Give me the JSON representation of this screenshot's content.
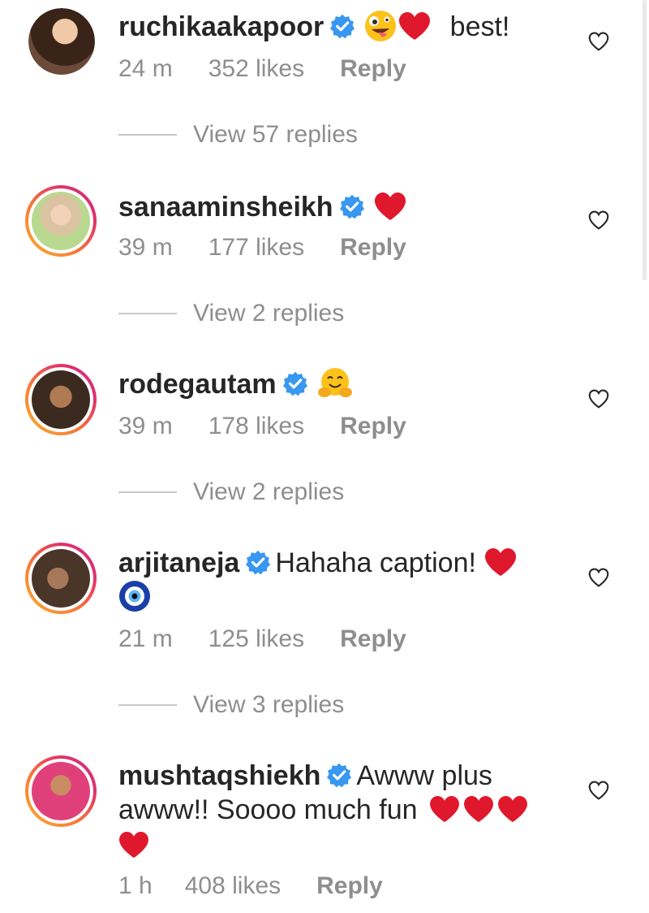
{
  "comments": [
    {
      "username": "ruchikaakapoor",
      "text": "best!",
      "time": "24 m",
      "likes": "352 likes",
      "reply": "Reply",
      "view_replies": "View 57 replies",
      "emojis": [
        "zany-face",
        "red-heart"
      ]
    },
    {
      "username": "sanaaminsheikh",
      "text": "",
      "time": "39 m",
      "likes": "177 likes",
      "reply": "Reply",
      "view_replies": "View 2 replies",
      "emojis": [
        "red-heart"
      ]
    },
    {
      "username": "rodegautam",
      "text": "",
      "time": "39 m",
      "likes": "178 likes",
      "reply": "Reply",
      "view_replies": "View 2 replies",
      "emojis": [
        "hugging-face"
      ]
    },
    {
      "username": "arjitaneja",
      "text": "Hahaha caption!",
      "time": "21 m",
      "likes": "125 likes",
      "reply": "Reply",
      "view_replies": "View 3 replies",
      "emojis": [
        "red-heart",
        "nazar-amulet"
      ]
    },
    {
      "username": "mushtaqshiekh",
      "text": "Awww plus",
      "text_line2": "awww!! Soooo much fun",
      "time": "1 h",
      "likes": "408 likes",
      "reply": "Reply",
      "emojis": [
        "red-heart",
        "red-heart",
        "red-heart",
        "red-heart"
      ]
    }
  ],
  "colors": {
    "text": "#262626",
    "meta": "#8e8e8e",
    "verified": "#3897f0",
    "heart": "#e0182d"
  }
}
